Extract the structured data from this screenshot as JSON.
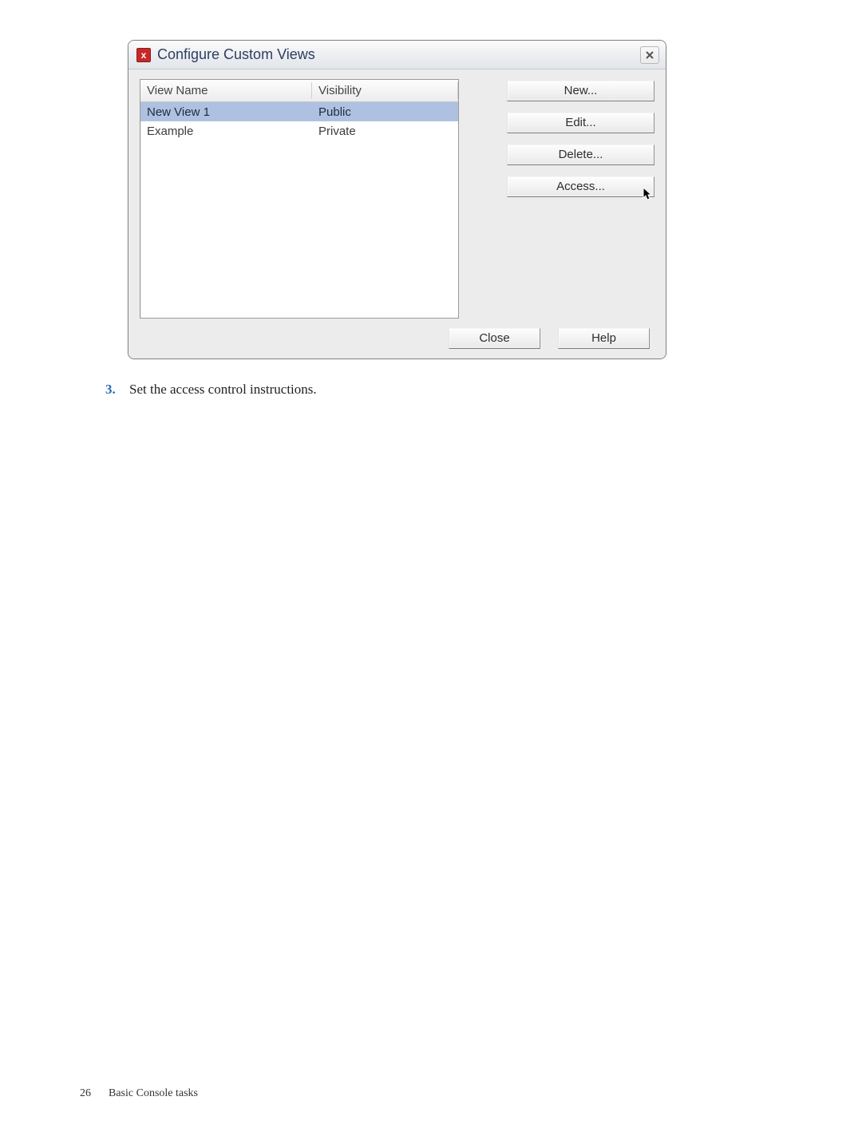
{
  "dialog": {
    "title": "Configure Custom Views",
    "columns": {
      "name": "View Name",
      "visibility": "Visibility"
    },
    "rows": [
      {
        "name": "New View 1",
        "visibility": "Public",
        "selected": true
      },
      {
        "name": "Example",
        "visibility": "Private",
        "selected": false
      }
    ],
    "buttons": {
      "new": "New...",
      "edit": "Edit...",
      "delete": "Delete...",
      "access": "Access..."
    },
    "footer": {
      "close": "Close",
      "help": "Help"
    }
  },
  "step": {
    "num": "3.",
    "text": "Set the access control instructions."
  },
  "page_footer": {
    "num": "26",
    "section": "Basic Console tasks"
  }
}
